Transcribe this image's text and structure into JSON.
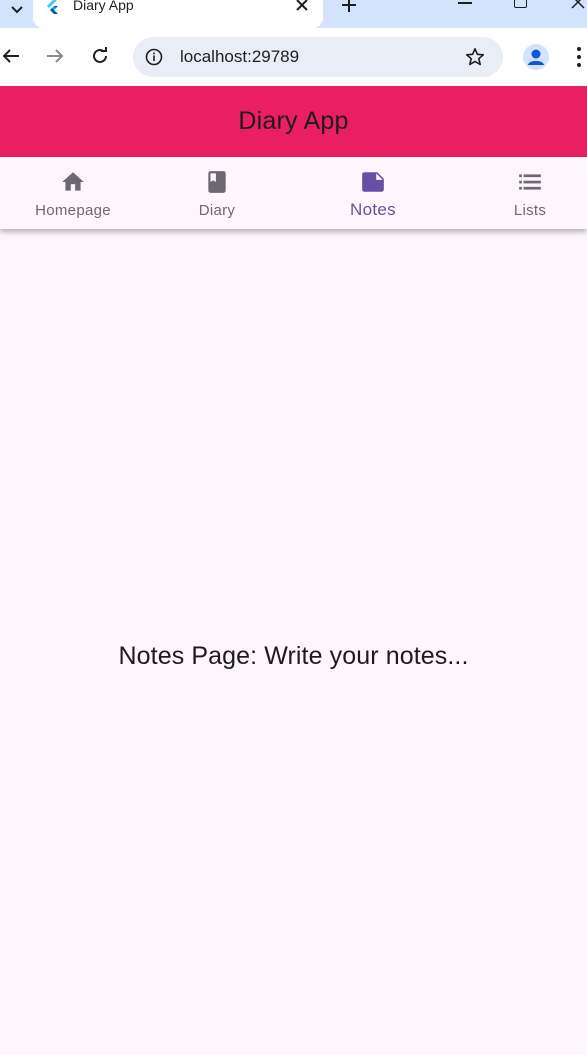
{
  "browser": {
    "tab": {
      "title": "Diary App",
      "favicon": "flutter-logo-icon"
    },
    "url": "localhost:29789",
    "icons": [
      "back-arrow-icon",
      "forward-arrow-icon",
      "reload-icon",
      "site-info-icon",
      "bookmark-star-icon",
      "profile-icon",
      "more-menu-icon"
    ]
  },
  "app": {
    "title": "Diary App",
    "accent_color": "#e91e63",
    "selected_color": "#6750a4"
  },
  "tabs": [
    {
      "label": "Homepage",
      "icon": "home-icon",
      "selected": false
    },
    {
      "label": "Diary",
      "icon": "book-icon",
      "selected": false
    },
    {
      "label": "Notes",
      "icon": "note-icon",
      "selected": true
    },
    {
      "label": "Lists",
      "icon": "list-icon",
      "selected": false
    }
  ],
  "page": {
    "message": "Notes Page: Write your notes..."
  }
}
